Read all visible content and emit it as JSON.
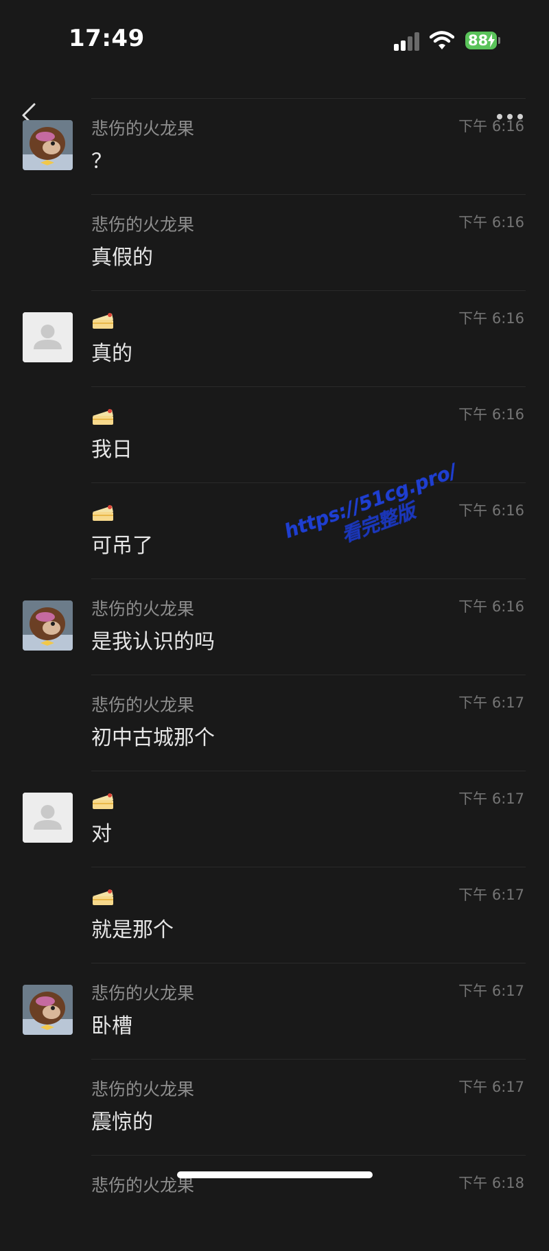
{
  "status_bar": {
    "time": "17:49",
    "battery": "88"
  },
  "colors": {
    "background": "#191919",
    "battery": "#5ac35a",
    "watermark": "#1f3fd0"
  },
  "messages": [
    {
      "sender": "悲伤的火龙果",
      "time": "下午 6:16",
      "text": "？",
      "avatar": "bear"
    },
    {
      "sender": "悲伤的火龙果",
      "time": "下午 6:16",
      "text": "真假的",
      "avatar": ""
    },
    {
      "sender": "",
      "sender_icon": "cake-icon",
      "time": "下午 6:16",
      "text": "真的",
      "avatar": "default"
    },
    {
      "sender": "",
      "sender_icon": "cake-icon",
      "time": "下午 6:16",
      "text": "我日",
      "avatar": ""
    },
    {
      "sender": "",
      "sender_icon": "cake-icon",
      "time": "下午 6:16",
      "text": "可吊了",
      "avatar": ""
    },
    {
      "sender": "悲伤的火龙果",
      "time": "下午 6:16",
      "text": "是我认识的吗",
      "avatar": "bear"
    },
    {
      "sender": "悲伤的火龙果",
      "time": "下午 6:17",
      "text": "初中古城那个",
      "avatar": ""
    },
    {
      "sender": "",
      "sender_icon": "cake-icon",
      "time": "下午 6:17",
      "text": "对",
      "avatar": "default"
    },
    {
      "sender": "",
      "sender_icon": "cake-icon",
      "time": "下午 6:17",
      "text": "就是那个",
      "avatar": ""
    },
    {
      "sender": "悲伤的火龙果",
      "time": "下午 6:17",
      "text": "卧槽",
      "avatar": "bear"
    },
    {
      "sender": "悲伤的火龙果",
      "time": "下午 6:17",
      "text": "震惊的",
      "avatar": ""
    },
    {
      "sender": "悲伤的火龙果",
      "time": "下午 6:18",
      "text": "",
      "avatar": ""
    }
  ],
  "watermark": {
    "line1": "https://51cg.pro/",
    "line2": "看完整版"
  }
}
